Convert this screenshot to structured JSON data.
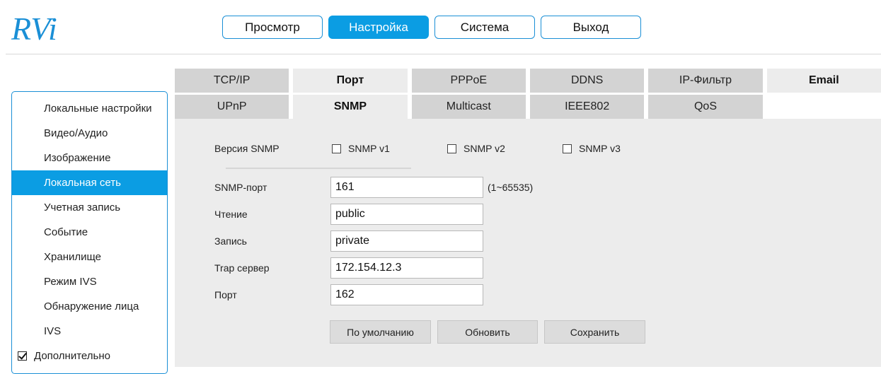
{
  "header": {
    "logo_text": "RVi",
    "brand_color": "#1a8fd6",
    "nav": [
      {
        "label": "Просмотр",
        "active": false
      },
      {
        "label": "Настройка",
        "active": true
      },
      {
        "label": "Система",
        "active": false
      },
      {
        "label": "Выход",
        "active": false
      }
    ]
  },
  "sidebar": {
    "items": [
      {
        "label": "Локальные настройки",
        "active": false
      },
      {
        "label": "Видео/Аудио",
        "active": false
      },
      {
        "label": "Изображение",
        "active": false
      },
      {
        "label": "Локальная сеть",
        "active": true
      },
      {
        "label": "Учетная запись",
        "active": false
      },
      {
        "label": "Событие",
        "active": false
      },
      {
        "label": "Хранилище",
        "active": false
      },
      {
        "label": "Режим IVS",
        "active": false
      },
      {
        "label": "Обнаружение лица",
        "active": false
      },
      {
        "label": "IVS",
        "active": false
      }
    ],
    "advanced": {
      "label": "Дополнительно",
      "checked": true
    }
  },
  "tabs": {
    "row1": [
      "TCP/IP",
      "Порт",
      "PPPoE",
      "DDNS",
      "IP-Фильтр",
      "Email"
    ],
    "row2": [
      "UPnP",
      "SNMP",
      "Multicast",
      "IEEE802",
      "QoS"
    ],
    "active": "SNMP"
  },
  "snmp": {
    "version_label": "Версия SNMP",
    "versions": [
      {
        "label": "SNMP v1",
        "checked": false
      },
      {
        "label": "SNMP v2",
        "checked": false
      },
      {
        "label": "SNMP v3",
        "checked": false
      }
    ],
    "port_label": "SNMP-порт",
    "port_value": "161",
    "port_hint": "(1~65535)",
    "read_label": "Чтение",
    "read_value": "public",
    "write_label": "Запись",
    "write_value": "private",
    "trap_label": "Trap сервер",
    "trap_value": "172.154.12.3",
    "trap_port_label": "Порт",
    "trap_port_value": "162"
  },
  "buttons": {
    "default": "По умолчанию",
    "refresh": "Обновить",
    "save": "Сохранить"
  }
}
